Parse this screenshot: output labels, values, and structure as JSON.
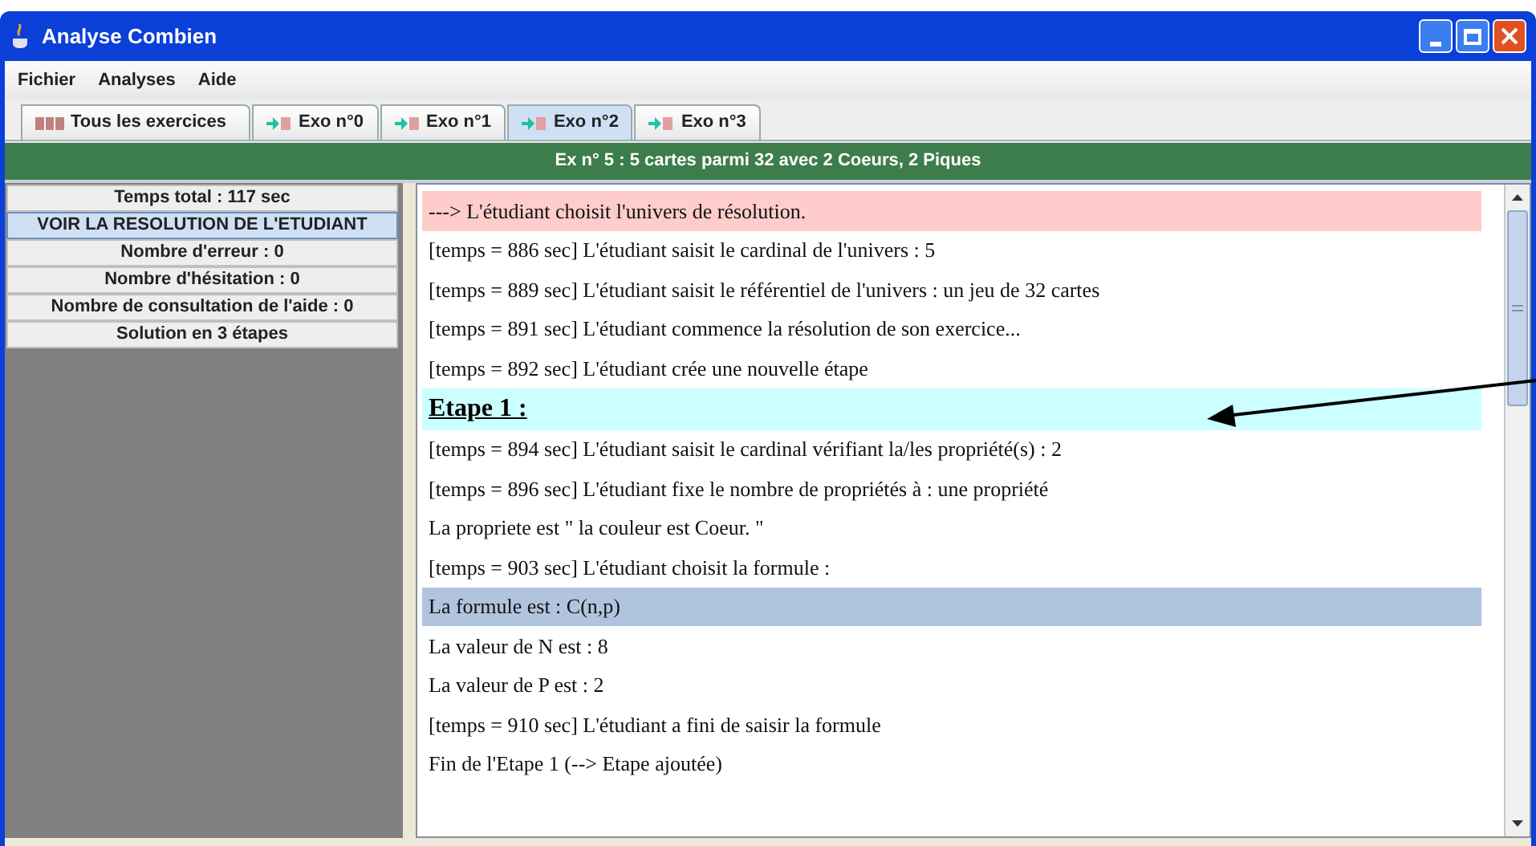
{
  "window": {
    "title": "Analyse Combien"
  },
  "menu": [
    "Fichier",
    "Analyses",
    "Aide"
  ],
  "tabs": [
    {
      "label": "Tous les exercices",
      "kind": "all",
      "selected": false
    },
    {
      "label": "Exo n°0",
      "kind": "exo",
      "selected": false
    },
    {
      "label": "Exo n°1",
      "kind": "exo",
      "selected": false
    },
    {
      "label": "Exo n°2",
      "kind": "exo",
      "selected": true
    },
    {
      "label": "Exo n°3",
      "kind": "exo",
      "selected": false
    }
  ],
  "header": "Ex n° 5 : 5 cartes parmi 32 avec 2 Coeurs, 2 Piques",
  "sidebar": {
    "items": [
      {
        "label": "Temps total : 117 sec",
        "selected": false
      },
      {
        "label": "VOIR LA RESOLUTION DE L'ETUDIANT",
        "selected": true
      },
      {
        "label": "Nombre d'erreur : 0",
        "selected": false
      },
      {
        "label": "Nombre d'hésitation : 0",
        "selected": false
      },
      {
        "label": "Nombre de consultation de l'aide : 0",
        "selected": false
      },
      {
        "label": "Solution en 3 étapes",
        "selected": false
      }
    ]
  },
  "log": [
    {
      "text": "---> L'étudiant choisit l'univers de résolution.",
      "kind": "line",
      "color": "#ffcccc"
    },
    {
      "text": "[temps = 886 sec] L'étudiant saisit le cardinal de l'univers : 5",
      "kind": "line"
    },
    {
      "text": "[temps = 889 sec] L'étudiant saisit le référentiel de l'univers : un jeu de 32 cartes",
      "kind": "line"
    },
    {
      "text": "[temps = 891 sec] L'étudiant commence la résolution de son exercice...",
      "kind": "line"
    },
    {
      "text": "[temps = 892 sec] L'étudiant crée une nouvelle étape",
      "kind": "line"
    },
    {
      "text": "Etape 1 :",
      "kind": "heading",
      "color": "#ccffff"
    },
    {
      "text": "[temps = 894 sec] L'étudiant saisit le cardinal vérifiant la/les propriété(s) : 2",
      "kind": "line"
    },
    {
      "text": "[temps = 896 sec] L'étudiant fixe le nombre de propriétés à  : une propriété",
      "kind": "line"
    },
    {
      "text": "La propriete est \" la couleur est Coeur. \"",
      "kind": "line"
    },
    {
      "text": "[temps = 903 sec] L'étudiant choisit la formule :",
      "kind": "line"
    },
    {
      "text": "La formule est : C(n,p)",
      "kind": "line",
      "color": "#b0c4de"
    },
    {
      "text": "La valeur de N est : 8",
      "kind": "line"
    },
    {
      "text": "La valeur de P est : 2",
      "kind": "line"
    },
    {
      "text": "[temps = 910 sec] L'étudiant a fini de saisir la formule",
      "kind": "line"
    },
    {
      "text": "Fin de l'Etape 1 (--> Etape ajoutée)",
      "kind": "line"
    }
  ]
}
